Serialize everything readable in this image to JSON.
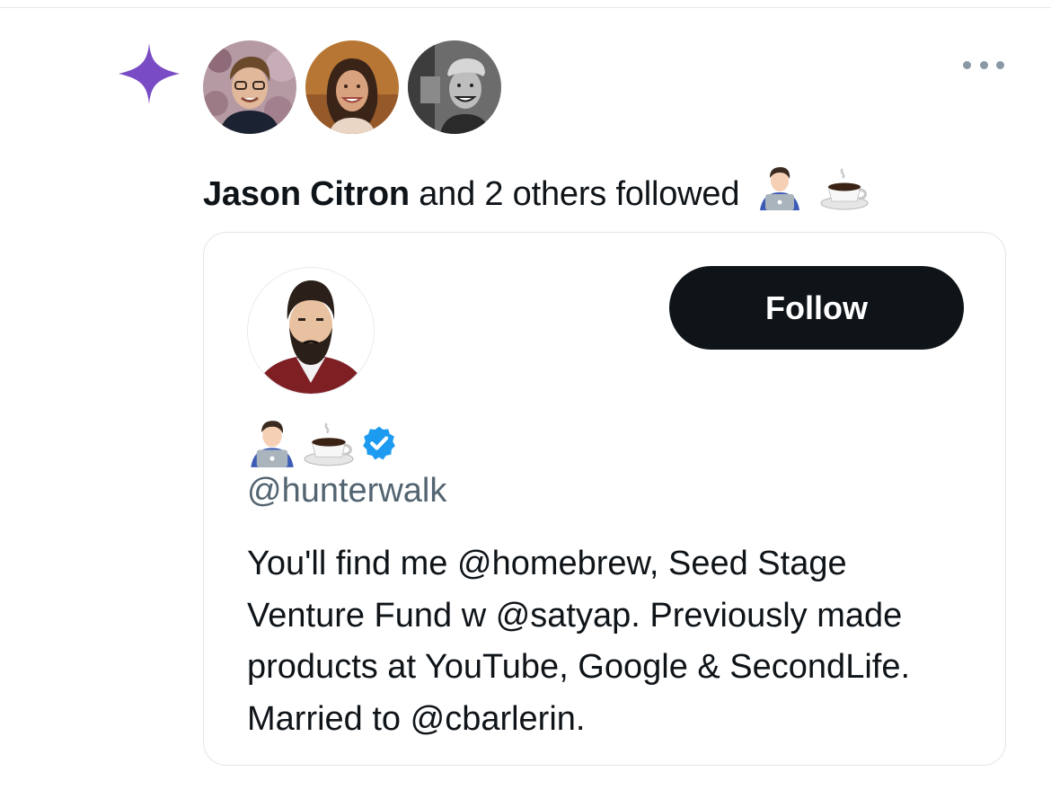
{
  "activity": {
    "icon": "sparkle-icon",
    "actor_name": "Jason Citron",
    "action_text": "and 2 others followed",
    "actor_avatars": [
      "avatar-jason-citron",
      "avatar-follower-2",
      "avatar-follower-3"
    ],
    "more_icon": "more-options-icon"
  },
  "profile_card": {
    "avatar": "profile-avatar-illustration",
    "display_name_emoji": [
      "technologist-emoji",
      "coffee-emoji"
    ],
    "verified_icon": "verified-badge-icon",
    "handle": "@hunterwalk",
    "follow_label": "Follow",
    "bio": "You'll find me @homebrew, Seed Stage Venture Fund w @satyap. Previously made products at YouTube, Google & SecondLife. Married to @cbarlerin."
  },
  "colors": {
    "sparkle": "#794bc4",
    "verified": "#1d9bf0",
    "follow_button_bg": "#0f1419",
    "follow_button_text": "#ffffff",
    "handle_text": "#536471",
    "card_border": "#e2e6e9"
  }
}
